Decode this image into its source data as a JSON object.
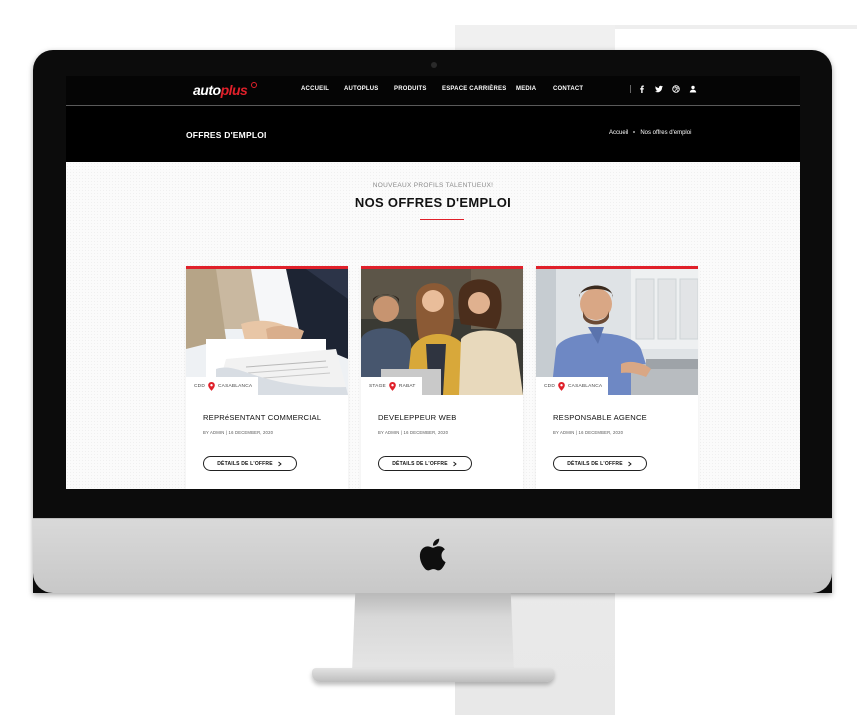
{
  "brand": {
    "logo_part1": "auto",
    "logo_part2": "plus",
    "accent_color": "#e0202a"
  },
  "nav": {
    "items": [
      {
        "label": "ACCUEIL"
      },
      {
        "label": "AUTOPLUS"
      },
      {
        "label": "PRODUITS"
      },
      {
        "label": "ESPACE CARRIÈRES"
      },
      {
        "label": "MEDIA"
      },
      {
        "label": "CONTACT"
      }
    ],
    "social_icons": [
      "facebook-icon",
      "twitter-icon",
      "dribbble-icon",
      "user-icon"
    ]
  },
  "page_header": {
    "title": "OFFRES D'EMPLOI",
    "breadcrumb": {
      "home": "Accueil",
      "current": "Nos offres d'emploi"
    }
  },
  "section": {
    "kicker": "NOUVEAUX PROFILS TALENTUEUX!",
    "title": "NOS OFFRES D'EMPLOI"
  },
  "jobs": [
    {
      "contract": "CDD",
      "city": "CASABLANCA",
      "title": "REPRéSENTANT COMMERCIAL",
      "meta": "BY ADMIN  |  16 DECEMBER, 2020",
      "cta": "DÉTAILS DE L'OFFRE"
    },
    {
      "contract": "STAGE",
      "city": "RABAT",
      "title": "DEVELEPPEUR WEB",
      "meta": "BY ADMIN  |  16 DECEMBER, 2020",
      "cta": "DÉTAILS DE L'OFFRE"
    },
    {
      "contract": "CDD",
      "city": "CASABLANCA",
      "title": "RESPONSABLE AGENCE",
      "meta": "BY ADMIN  |  16 DECEMBER, 2020",
      "cta": "DÉTAILS DE L'OFFRE"
    }
  ]
}
